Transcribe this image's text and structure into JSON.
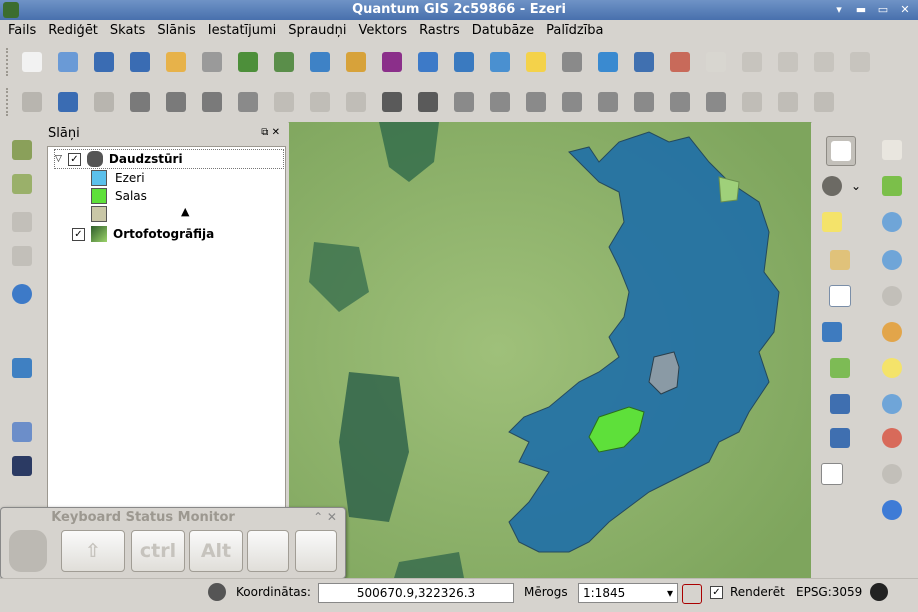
{
  "window": {
    "title": "Quantum GIS 2c59866 - Ezeri",
    "controls": [
      "▾",
      "▬",
      "▭",
      "✕"
    ]
  },
  "menu": [
    "Fails",
    "Rediģēt",
    "Skats",
    "Slānis",
    "Iestatījumi",
    "Spraudņi",
    "Vektors",
    "Rastrs",
    "Datubāze",
    "Palīdzība"
  ],
  "toolbar1_icons": [
    "new-project-icon",
    "open-project-icon",
    "save-project-icon",
    "save-as-icon",
    "new-print-composer-icon",
    "print-icon",
    "add-vector-layer-icon",
    "add-raster-layer-icon",
    "add-postgis-layer-icon",
    "add-spatialite-layer-icon",
    "add-mssql-layer-icon",
    "add-wms-layer-icon",
    "add-wcs-layer-icon",
    "add-wfs-layer-icon",
    "new-layer-icon",
    "remove-layer-icon",
    "new-shapefile-icon",
    "spell-check-icon",
    "label-icon",
    "tag-icon",
    "eye-tag-icon",
    "pin-tag-icon",
    "move-tag-icon",
    "rotate-tag-icon"
  ],
  "toolbar2_icons": [
    "save-edits-icon",
    "toggle-editing-icon",
    "save-layer-icon",
    "add-feature-icon",
    "move-feature-icon",
    "node-tool-icon",
    "delete-selected-icon",
    "cut-features-icon",
    "copy-features-icon",
    "paste-features-icon",
    "undo-icon",
    "redo-icon",
    "simplify-icon",
    "add-ring-icon",
    "add-part-icon",
    "delete-ring-icon",
    "delete-part-icon",
    "reshape-icon",
    "offset-curve-icon",
    "split-features-icon",
    "merge-features-icon",
    "merge-attributes-icon",
    "rotate-point-icon"
  ],
  "layers_panel": {
    "title": "Slāņi",
    "layers": [
      {
        "name": "Daudzstūri",
        "checked": true,
        "expanded": true,
        "classes": [
          {
            "label": "Ezeri",
            "color": "#5bc0eb"
          },
          {
            "label": "Salas",
            "color": "#5ee03a"
          },
          {
            "label": "",
            "color": "#c9c7a7"
          }
        ]
      },
      {
        "name": "Ortofotogrāfija",
        "checked": true,
        "expanded": false,
        "classes": []
      }
    ]
  },
  "keyboard_monitor": {
    "title": "Keyboard Status Monitor",
    "keys": [
      "⇧",
      "ctrl",
      "Alt",
      "",
      ""
    ]
  },
  "status": {
    "coord_label": "Koordinātas:",
    "coord_value": "500670.9,322326.3",
    "scale_label": "Mērogs",
    "scale_value": "1:1845",
    "render_label": "Renderēt",
    "render_checked": true,
    "epsg": "EPSG:3059"
  },
  "colors": {
    "lake": "#1f6fa8",
    "islands": "#5ee03a",
    "orthophoto": "#8fb36a",
    "title_bar": "#5a80b9"
  }
}
